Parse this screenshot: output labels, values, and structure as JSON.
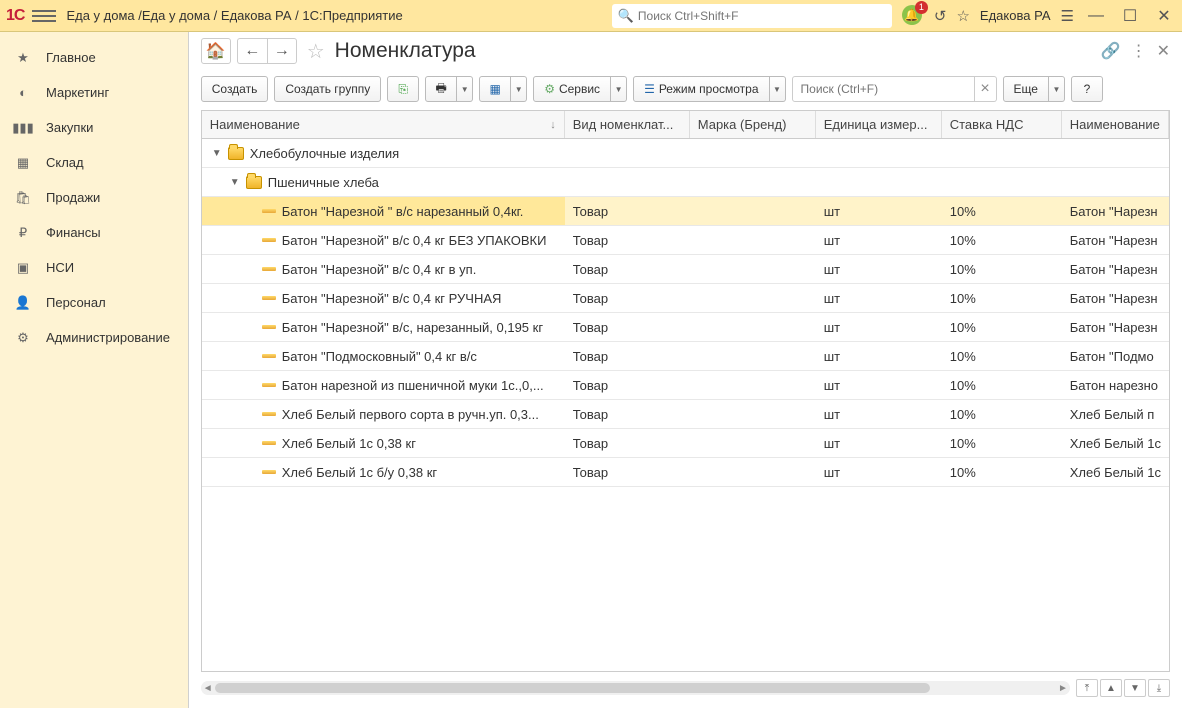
{
  "titlebar": {
    "app_title": "Еда у дома /Еда у дома / Едакова РА / 1С:Предприятие",
    "search_placeholder": "Поиск Ctrl+Shift+F",
    "notification_count": "1",
    "user": "Едакова РА"
  },
  "sidebar": {
    "items": [
      {
        "label": "Главное",
        "icon": "star"
      },
      {
        "label": "Маркетинг",
        "icon": "pie"
      },
      {
        "label": "Закупки",
        "icon": "barcode"
      },
      {
        "label": "Склад",
        "icon": "grid"
      },
      {
        "label": "Продажи",
        "icon": "basket"
      },
      {
        "label": "Финансы",
        "icon": "ruble"
      },
      {
        "label": "НСИ",
        "icon": "book"
      },
      {
        "label": "Персонал",
        "icon": "person"
      },
      {
        "label": "Администрирование",
        "icon": "gear"
      }
    ]
  },
  "page": {
    "title": "Номенклатура"
  },
  "toolbar": {
    "create": "Создать",
    "create_group": "Создать группу",
    "service": "Сервис",
    "view_mode": "Режим просмотра",
    "search_placeholder": "Поиск (Ctrl+F)",
    "more": "Еще",
    "help": "?"
  },
  "table": {
    "columns": {
      "name": "Наименование",
      "type": "Вид номенклат...",
      "brand": "Марка (Бренд)",
      "unit": "Единица измер...",
      "vat": "Ставка НДС",
      "name2": "Наименование"
    },
    "group1": {
      "label": "Хлебобулочные изделия"
    },
    "group2": {
      "label": "Пшеничные хлеба"
    },
    "rows": [
      {
        "name": "Батон \"Нарезной \"  в/с нарезанный 0,4кг.",
        "type": "Товар",
        "brand": "",
        "unit": "шт",
        "vat": "10%",
        "name2": "Батон \"Нарезн"
      },
      {
        "name": "Батон \"Нарезной\" в/с 0,4 кг БЕЗ УПАКОВКИ",
        "type": "Товар",
        "brand": "",
        "unit": "шт",
        "vat": "10%",
        "name2": "Батон \"Нарезн"
      },
      {
        "name": "Батон \"Нарезной\" в/с 0,4 кг в уп.",
        "type": "Товар",
        "brand": "",
        "unit": "шт",
        "vat": "10%",
        "name2": "Батон \"Нарезн"
      },
      {
        "name": "Батон \"Нарезной\" в/с 0,4 кг РУЧНАЯ",
        "type": "Товар",
        "brand": "",
        "unit": "шт",
        "vat": "10%",
        "name2": "Батон \"Нарезн"
      },
      {
        "name": "Батон \"Нарезной\" в/с, нарезанный, 0,195 кг",
        "type": "Товар",
        "brand": "",
        "unit": "шт",
        "vat": "10%",
        "name2": "Батон \"Нарезн"
      },
      {
        "name": "Батон \"Подмосковный\" 0,4 кг в/с",
        "type": "Товар",
        "brand": "",
        "unit": "шт",
        "vat": "10%",
        "name2": "Батон \"Подмо"
      },
      {
        "name": "Батон нарезной из пшеничной муки 1с.,0,...",
        "type": "Товар",
        "brand": "",
        "unit": "шт",
        "vat": "10%",
        "name2": "Батон нарезно"
      },
      {
        "name": "Хлеб Белый  первого сорта в ручн.уп. 0,3...",
        "type": "Товар",
        "brand": "",
        "unit": "шт",
        "vat": "10%",
        "name2": "Хлеб Белый  п"
      },
      {
        "name": "Хлеб Белый 1с 0,38 кг",
        "type": "Товар",
        "brand": "",
        "unit": "шт",
        "vat": "10%",
        "name2": "Хлеб Белый 1с"
      },
      {
        "name": "Хлеб Белый 1с б/у 0,38 кг",
        "type": "Товар",
        "brand": "",
        "unit": "шт",
        "vat": "10%",
        "name2": "Хлеб Белый 1с"
      }
    ]
  }
}
